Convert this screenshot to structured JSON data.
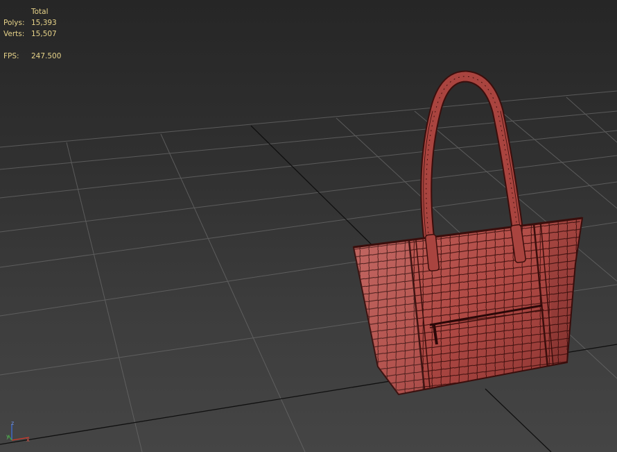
{
  "viewport": {
    "stats": {
      "header": "Total",
      "polys_label": "Polys:",
      "polys_value": "15,393",
      "verts_label": "Verts:",
      "verts_value": "15,507",
      "fps_label": "FPS:",
      "fps_value": "247.500"
    },
    "axis_gizmo": {
      "z_label": "z",
      "y_label": "y",
      "x_label": "x"
    }
  },
  "colors": {
    "background_top": "#262626",
    "background_bottom": "#454545",
    "grid_line": "#6a6a6a",
    "grid_axis": "#0f0f0f",
    "stats_text": "#e8d48a",
    "mesh_fill": "#b04a45",
    "mesh_wire": "#3a0e0c"
  },
  "icons": {
    "gizmo": "xyz-axis-gizmo-icon"
  }
}
